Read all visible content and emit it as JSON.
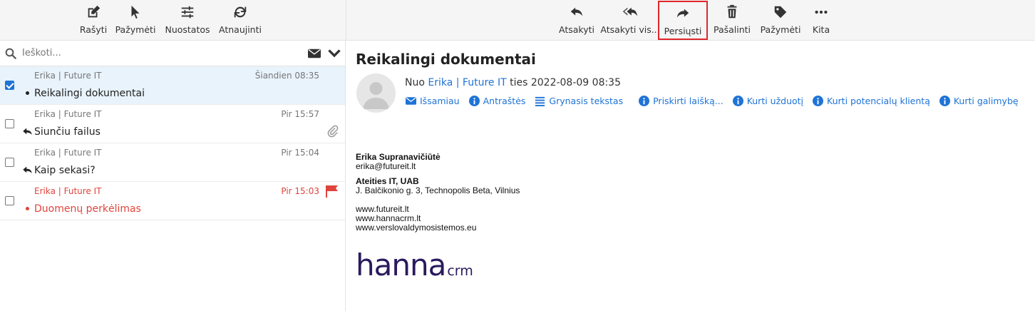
{
  "left_toolbar": [
    {
      "label": "Rašyti",
      "icon": "compose-icon"
    },
    {
      "label": "Pažymėti",
      "icon": "cursor-icon"
    },
    {
      "label": "Nuostatos",
      "icon": "sliders-icon"
    },
    {
      "label": "Atnaujinti",
      "icon": "refresh-icon"
    }
  ],
  "right_toolbar": [
    {
      "label": "Atsakyti",
      "icon": "reply-icon"
    },
    {
      "label": "Atsakyti vis...",
      "icon": "reply-all-icon"
    },
    {
      "label": "Persiųsti",
      "icon": "forward-icon"
    },
    {
      "label": "Pašalinti",
      "icon": "trash-icon"
    },
    {
      "label": "Pažymėti",
      "icon": "tag-icon"
    },
    {
      "label": "Kita",
      "icon": "more-icon"
    }
  ],
  "search": {
    "placeholder": "Ieškoti..."
  },
  "messages": [
    {
      "from": "Erika | Future IT",
      "time": "Šiandien 08:35",
      "subject": "Reikalingi dokumentai",
      "checked": true,
      "status": "unread"
    },
    {
      "from": "Erika | Future IT",
      "time": "Pir 15:57",
      "subject": "Siunčiu failus",
      "checked": false,
      "status": "replied",
      "attachment": true
    },
    {
      "from": "Erika | Future IT",
      "time": "Pir 15:04",
      "subject": "Kaip sekasi?",
      "checked": false,
      "status": "replied"
    },
    {
      "from": "Erika | Future IT",
      "time": "Pir 15:03",
      "subject": "Duomenų perkėlimas",
      "checked": false,
      "status": "unread",
      "flagged": true
    }
  ],
  "mail": {
    "subject": "Reikalingi dokumentai",
    "from_prefix": "Nuo",
    "from_name": "Erika | Future IT",
    "to_word": "ties",
    "date": "2022-08-09 08:35",
    "actions": [
      {
        "label": "Išsamiau",
        "icon": "envelope-icon"
      },
      {
        "label": "Antraštės",
        "icon": "info-icon"
      },
      {
        "label": "Grynasis tekstas",
        "icon": "lines-icon"
      },
      {
        "label": "Priskirti laišką...",
        "icon": "info-icon"
      },
      {
        "label": "Kurti užduotį",
        "icon": "info-icon"
      },
      {
        "label": "Kurti potencialų klientą",
        "icon": "info-icon"
      },
      {
        "label": "Kurti galimybę",
        "icon": "info-icon"
      }
    ],
    "signature": {
      "name": "Erika Supranavičiūtė",
      "email": "erika@futureit.lt",
      "company": "Ateities IT, UAB",
      "address": "J. Balčikonio g. 3, Technopolis Beta, Vilnius",
      "links": [
        "www.futureit.lt",
        "www.hannacrm.lt",
        "www.verslovaldymosistemos.eu"
      ],
      "logo_text": "hanna",
      "logo_sub": "crm"
    }
  },
  "colors": {
    "accent": "#1e73d6",
    "flag": "#e0443c",
    "highlight": "#e0262b",
    "logo": "#2a1a5e"
  }
}
